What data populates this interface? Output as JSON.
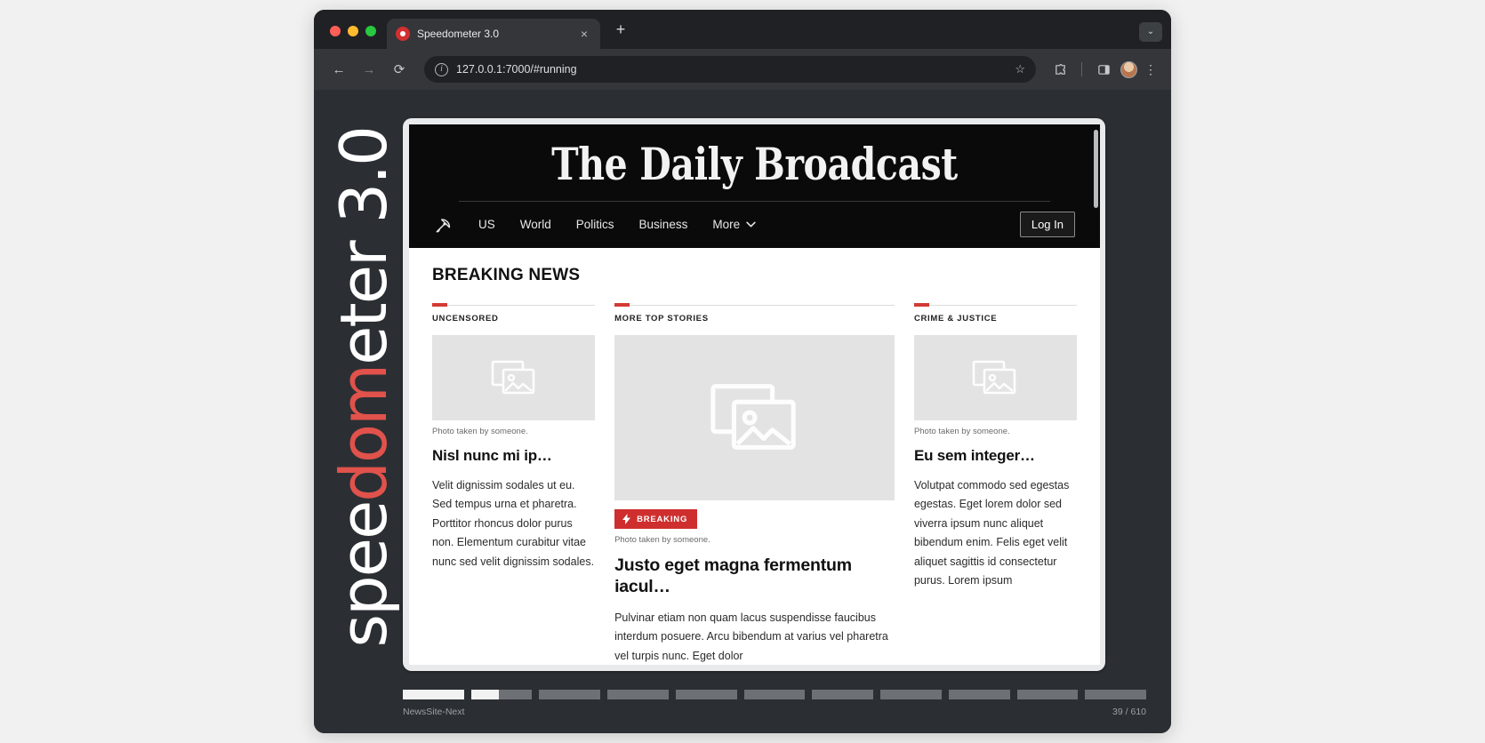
{
  "browser": {
    "tab": {
      "title": "Speedometer 3.0",
      "favicon": "speedometer-favicon",
      "close_label": "×"
    },
    "new_tab_label": "+",
    "tabstrip_menu_label": "⌄",
    "toolbar": {
      "back_label": "←",
      "forward_label": "→",
      "reload_label": "⟳",
      "url": "127.0.0.1:7000/#running",
      "info_label": "i",
      "star_label": "☆",
      "menu_label": "⋮"
    }
  },
  "speedometer": {
    "wordmark_before": "spee",
    "wordmark_accent": "dom",
    "wordmark_after": "eter 3.0",
    "suite_name": "NewsSite-Next",
    "progress_text": "39 / 610",
    "progress_segments": [
      1,
      0.45,
      0,
      0,
      0,
      0,
      0,
      0,
      0,
      0,
      0
    ]
  },
  "site": {
    "masthead": "The Daily Broadcast",
    "nav": {
      "logo_icon": "satellite-dish-icon",
      "items": [
        "US",
        "World",
        "Politics",
        "Business"
      ],
      "more_label": "More",
      "login_label": "Log In"
    },
    "section_title": "BREAKING NEWS",
    "columns": [
      {
        "kicker": "UNCENSORED",
        "caption": "Photo taken by someone.",
        "headline": "Nisl nunc mi ip…",
        "dek": "Velit dignissim sodales ut eu. Sed tempus urna et pharetra. Porttitor rhoncus dolor purus non. Elementum curabitur vitae nunc sed velit dignissim sodales."
      },
      {
        "kicker": "MORE TOP STORIES",
        "badge": "BREAKING",
        "caption": "Photo taken by someone.",
        "headline": "Justo eget magna fermentum iacul…",
        "dek": "Pulvinar etiam non quam lacus suspendisse faucibus interdum posuere. Arcu bibendum at varius vel pharetra vel turpis nunc. Eget dolor"
      },
      {
        "kicker": "CRIME & JUSTICE",
        "caption": "Photo taken by someone.",
        "headline": "Eu sem integer…",
        "dek": "Volutpat commodo sed egestas egestas. Eget lorem dolor sed viverra ipsum nunc aliquet bibendum enim. Felis eget velit aliquet sagittis id consectetur purus. Lorem ipsum"
      }
    ]
  },
  "colors": {
    "accent_red": "#d33a35",
    "badge_red": "#cf2e2e",
    "wordmark_accent": "#e0524b"
  }
}
